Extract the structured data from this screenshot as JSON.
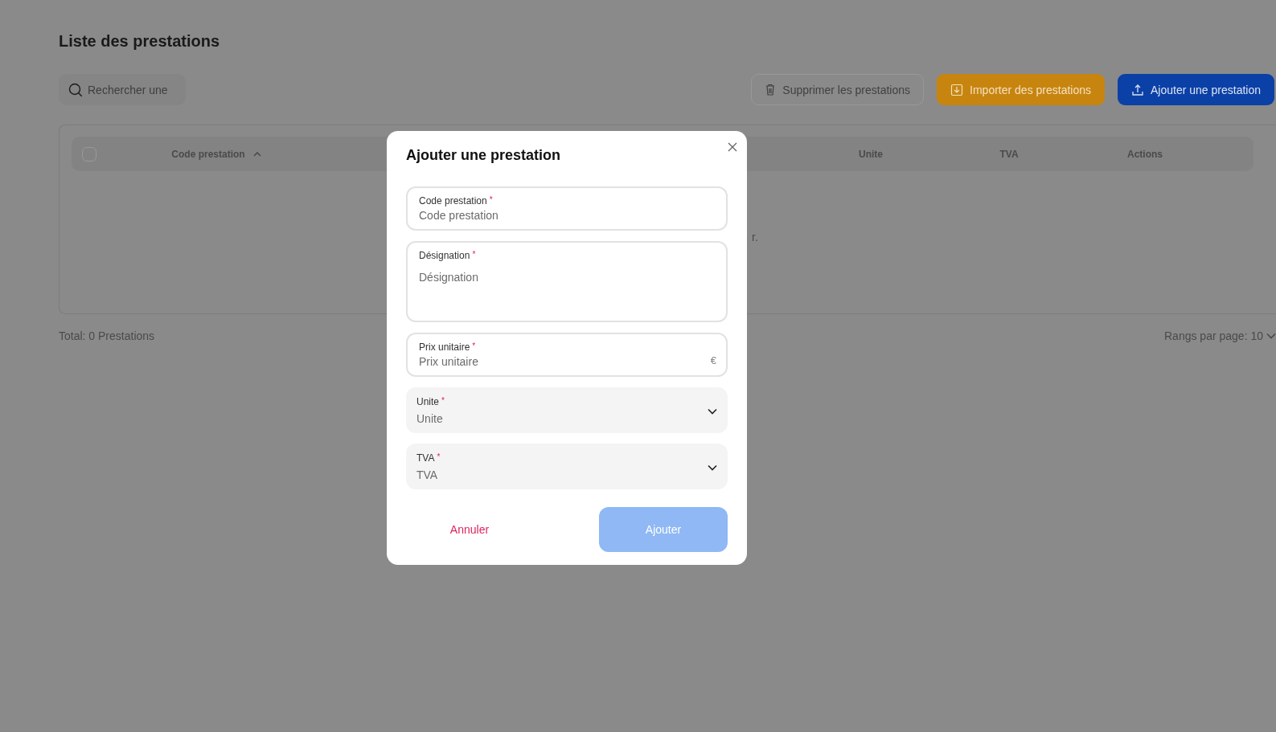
{
  "page": {
    "title": "Liste des prestations"
  },
  "search": {
    "placeholder": "Rechercher une"
  },
  "actions": [
    {
      "kind": "delete",
      "label": "Supprimer les prestations",
      "disabled": true
    },
    {
      "kind": "import",
      "label": "Importer des prestations",
      "disabled": false
    },
    {
      "kind": "add",
      "label": "Ajouter une prestation",
      "disabled": false
    }
  ],
  "table": {
    "select_all_checked": false,
    "columns": [
      {
        "label": "Code prestation",
        "sorted": true
      },
      {
        "label": "Unite",
        "sorted": false
      },
      {
        "label": "TVA",
        "sorted": false
      },
      {
        "label": "Actions",
        "sorted": false
      }
    ],
    "empty_message": "r."
  },
  "footer": {
    "total": "Total: 0 Prestations",
    "rows_per_page_label": "Rangs par page:",
    "rows_per_page": "10"
  },
  "modal": {
    "title": "Ajouter une prestation",
    "required_mark": "*",
    "fields": [
      {
        "kind": "text",
        "label": "Code prestation",
        "required": true,
        "placeholder": "Code prestation"
      },
      {
        "kind": "textarea",
        "label": "Désignation",
        "required": true,
        "placeholder": "Désignation"
      },
      {
        "kind": "text",
        "label": "Prix unitaire",
        "required": true,
        "placeholder": "Prix unitaire",
        "suffix": "€"
      },
      {
        "kind": "select",
        "label": "Unite",
        "required": true,
        "placeholder": "Unite"
      },
      {
        "kind": "select",
        "label": "TVA",
        "required": true,
        "placeholder": "TVA"
      }
    ],
    "cancel": "Annuler",
    "submit": {
      "label": "Ajouter",
      "disabled": true
    }
  }
}
